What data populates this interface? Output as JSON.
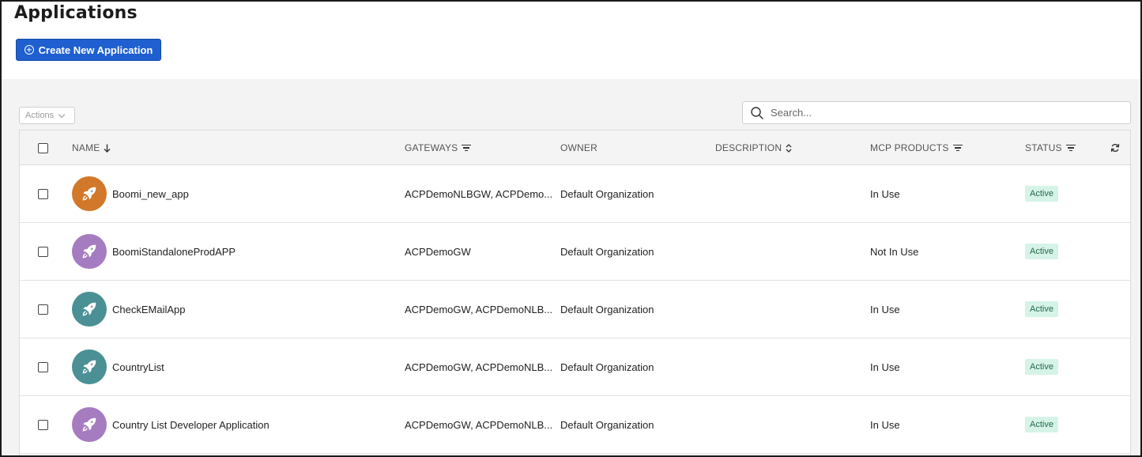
{
  "page": {
    "title": "Applications"
  },
  "toolbar": {
    "create_label": "Create New Application",
    "actions_label": "Actions",
    "search_placeholder": "Search..."
  },
  "table": {
    "headers": {
      "name": "NAME",
      "gateways": "GATEWAYS",
      "owner": "OWNER",
      "description": "DESCRIPTION",
      "mcp_products": "MCP PRODUCTS",
      "status": "STATUS"
    },
    "rows": [
      {
        "name": "Boomi_new_app",
        "gateways": "ACPDemoNLBGW, ACPDemo...",
        "owner": "Default Organization",
        "description": "",
        "mcp": "In Use",
        "status": "Active",
        "avatar_color": "#d2782a"
      },
      {
        "name": "BoomiStandaloneProdAPP",
        "gateways": "ACPDemoGW",
        "owner": "Default Organization",
        "description": "",
        "mcp": "Not In Use",
        "status": "Active",
        "avatar_color": "#a67cc0"
      },
      {
        "name": "CheckEMailApp",
        "gateways": "ACPDemoGW, ACPDemoNLB...",
        "owner": "Default Organization",
        "description": "",
        "mcp": "In Use",
        "status": "Active",
        "avatar_color": "#4a9095"
      },
      {
        "name": "CountryList",
        "gateways": "ACPDemoGW, ACPDemoNLB...",
        "owner": "Default Organization",
        "description": "",
        "mcp": "In Use",
        "status": "Active",
        "avatar_color": "#4a9095"
      },
      {
        "name": "Country List Developer Application",
        "gateways": "ACPDemoGW, ACPDemoNLB...",
        "owner": "Default Organization",
        "description": "",
        "mcp": "In Use",
        "status": "Active",
        "avatar_color": "#a67cc0"
      }
    ]
  },
  "colors": {
    "primary": "#1f5fd0",
    "status_badge_bg": "#d6f3e8",
    "status_badge_text": "#236b4a"
  },
  "icons": {
    "row_avatar": "rocket-icon",
    "name_sort": "arrow-down-icon",
    "description_sort": "sort-icon",
    "filter": "filter-icon",
    "refresh": "refresh-icon",
    "search": "search-icon"
  }
}
